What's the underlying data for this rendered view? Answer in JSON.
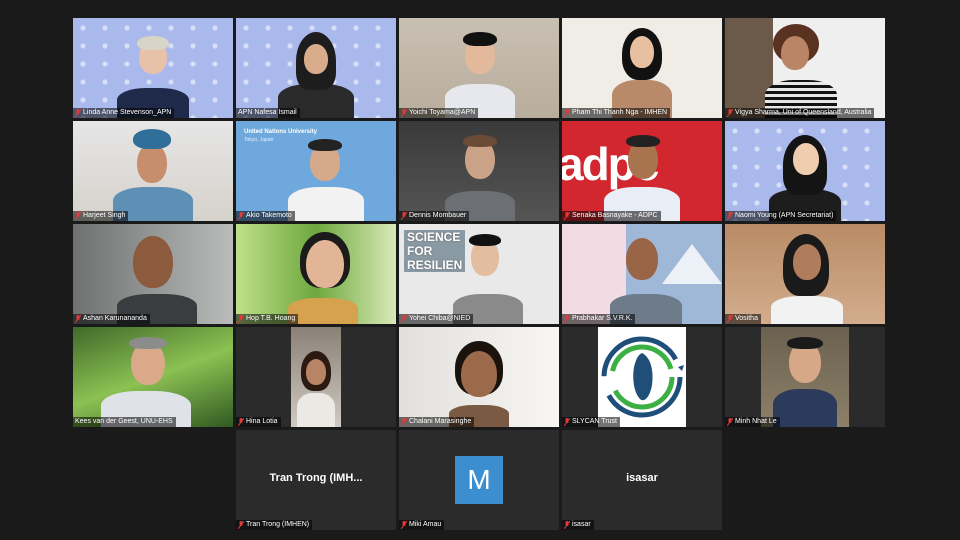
{
  "participants": [
    {
      "name": "Linda Anne Stevenson_APN"
    },
    {
      "name": "APN Nafesa Ismail"
    },
    {
      "name": "Yoichi Toyama@APN"
    },
    {
      "name": "Pham Thi Thanh Nga - IMHEN"
    },
    {
      "name": "Vigya Sharma, Uni of Queensland, Australia"
    },
    {
      "name": "Harjeet Singh"
    },
    {
      "name": "Akio Takemoto"
    },
    {
      "name": "Dennis Mombauer"
    },
    {
      "name": "Senaka Basnayake - ADPC"
    },
    {
      "name": "Naomi Young (APN Secretariat)"
    },
    {
      "name": "Ashan Karunananda"
    },
    {
      "name": "Hop T.B. Hoang"
    },
    {
      "name": "Yohei Chiba@NIED"
    },
    {
      "name": "Prabhakar S.V.R.K."
    },
    {
      "name": "Vositha"
    },
    {
      "name": "Kees van der Geest, UNU-EHS"
    },
    {
      "name": "Hina Lotia"
    },
    {
      "name": "Chalani Marasinghe"
    },
    {
      "name": "SLYCAN Trust"
    },
    {
      "name": "Minh Nhat Le"
    },
    {
      "name": "Tran Trong (IMHEN)",
      "display": "Tran Trong (IMH..."
    },
    {
      "name": "Miki Amau",
      "avatar_letter": "M"
    },
    {
      "name": "isasar",
      "display": "isasar"
    }
  ],
  "backgrounds": {
    "unu_title": "United Nations University",
    "unu_sub": "Tokyo, Japan",
    "adpc_logo": "adpc",
    "sfr_line1": "SCIENCE",
    "sfr_line2": "FOR",
    "sfr_line3": "RESILIEN"
  },
  "colors": {
    "active_speaker_border": "#c9d94b",
    "muted_mic": "#e03a3a",
    "avatar_blue": "#3b8fd0"
  }
}
